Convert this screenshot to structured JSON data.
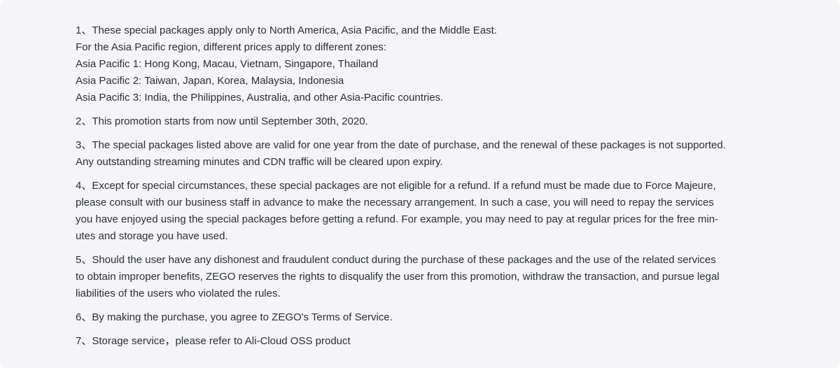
{
  "terms": [
    {
      "lines": [
        "1、These special packages apply only to North America, Asia Pacific, and the Middle East.",
        "For the Asia Pacific region, different prices apply to different zones:",
        "Asia Pacific 1: Hong Kong, Macau, Vietnam, Singapore, Thailand",
        "Asia Pacific 2: Taiwan, Japan, Korea, Malaysia, Indonesia",
        "Asia Pacific 3: India, the Philippines, Australia, and other Asia-Pacific countries."
      ]
    },
    {
      "lines": [
        "2、This promotion starts from now until September 30th, 2020."
      ]
    },
    {
      "lines": [
        "3、The special packages listed above are valid for one year from the date of purchase, and the renewal of these packages is not supported.",
        "Any outstanding streaming minutes and CDN traffic will be cleared upon expiry."
      ]
    },
    {
      "lines": [
        "4、Except for special circumstances, these special packages are not eligible for a refund. If a refund must be made due to Force Majeure,",
        "please consult with our business staff in advance to make the necessary arrangement. In such a case, you will need to repay the services",
        "you have enjoyed using the special packages before getting a refund. For example, you may need to pay at regular prices for the free min-",
        "utes and storage you have used."
      ]
    },
    {
      "lines": [
        "5、Should the user have any dishonest and fraudulent conduct during the purchase of these packages and the use of the related services",
        "to obtain improper benefits, ZEGO reserves the rights to disqualify the user from this promotion, withdraw the transaction,  and pursue legal",
        "liabilities of the users who violated the rules."
      ]
    },
    {
      "lines": [
        "6、By making the purchase, you agree to ZEGO's Terms of Service."
      ]
    },
    {
      "lines": [
        "7、Storage service，please  refer to Ali-Cloud OSS  product"
      ]
    }
  ]
}
